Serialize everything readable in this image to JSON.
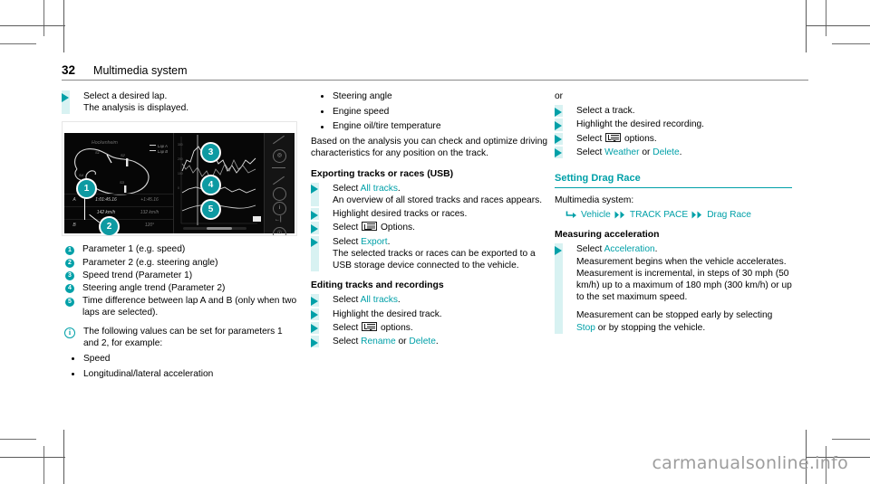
{
  "header": {
    "page_number": "32",
    "chapter_title": "Multimedia system"
  },
  "accent_color": "#00a0a8",
  "step_bar_color": "#d8f2f2",
  "column_1": {
    "step_select_lap": {
      "main": "Select a desired lap.",
      "sub": "The analysis is displayed."
    },
    "figure": {
      "track_name": "Hockenheim",
      "legend": [
        "Lap A",
        "Lap B"
      ],
      "table_rows": [
        {
          "label": "A",
          "v1": "1:01:45.16",
          "v2": "+1:45.16"
        },
        {
          "label": "",
          "v1": "142 km/h",
          "v2": "132 km/h"
        },
        {
          "label": "B",
          "v1": "120°",
          "v2": "120°"
        }
      ],
      "callouts": [
        "1",
        "2",
        "3",
        "4",
        "5"
      ]
    },
    "legend_items": [
      {
        "num": "1",
        "text": "Parameter 1 (e.g. speed)"
      },
      {
        "num": "2",
        "text": "Parameter 2 (e.g. steering angle)"
      },
      {
        "num": "3",
        "text": "Speed trend (Parameter 1)"
      },
      {
        "num": "4",
        "text": "Steering angle trend (Parameter 2)"
      },
      {
        "num": "5",
        "text": "Time difference between lap A and B (only when two laps are selected)."
      }
    ],
    "note": {
      "icon": "info-icon",
      "text": "The following values can be set for parameters 1 and 2, for example:"
    },
    "note_bullets": [
      "Speed",
      "Longitudinal/lateral acceleration"
    ]
  },
  "column_2": {
    "bullets": [
      "Steering angle",
      "Engine speed",
      "Engine oil/tire temperature"
    ],
    "paragraph": "Based on the analysis you can check and optimize driving characteristics for any position on the track.",
    "heading_export": "Exporting tracks or races (USB)",
    "export_steps": [
      {
        "pre": "Select ",
        "link": "All tracks",
        "post": ".",
        "sub": "An overview of all stored tracks and races appears."
      },
      {
        "pre": "Highlight desired tracks or races.",
        "link": "",
        "post": "",
        "sub": ""
      },
      {
        "pre": "Select ",
        "icon": "options-icon",
        "post": " Options.",
        "sub": ""
      },
      {
        "pre": "Select ",
        "link": "Export",
        "post": ".",
        "sub": "The selected tracks or races can be exported to a USB storage device connected to the vehicle."
      }
    ],
    "heading_editing": "Editing tracks and recordings",
    "editing_steps": [
      {
        "pre": "Select ",
        "link": "All tracks",
        "post": "."
      },
      {
        "pre": "Highlight the desired track.",
        "link": "",
        "post": ""
      },
      {
        "pre": "Select ",
        "icon": "options-icon",
        "post": " options."
      },
      {
        "pre": "Select ",
        "link": "Rename",
        "mid": " or ",
        "link2": "Delete",
        "post": "."
      }
    ]
  },
  "column_3": {
    "or_label": "or",
    "or_steps": [
      {
        "pre": "Select a track.",
        "link": "",
        "post": ""
      },
      {
        "pre": "Highlight the desired recording.",
        "link": "",
        "post": ""
      },
      {
        "pre": "Select ",
        "icon": "options-icon",
        "post": " options."
      },
      {
        "pre": "Select ",
        "link": "Weather",
        "mid": " or ",
        "link2": "Delete",
        "post": "."
      }
    ],
    "section_head": "Setting Drag Race",
    "system_label": "Multimedia system:",
    "breadcrumb": [
      "Vehicle",
      "TRACK PACE",
      "Drag Race"
    ],
    "heading_measuring": "Measuring acceleration",
    "measuring_step": {
      "pre": "Select ",
      "link": "Acceleration",
      "post": ".",
      "sub": "Measurement begins when the vehicle accelerates. Measurement is incremental, in steps of 30 mph (50 km/h) up to a maximum of 180 mph (300 km/h) or up to the set maximum speed."
    },
    "measuring_note": {
      "pre": "Measurement can be stopped early by selecting ",
      "link": "Stop",
      "post": " or by stopping the vehicle."
    }
  },
  "watermark": "carmanualsonline.info"
}
